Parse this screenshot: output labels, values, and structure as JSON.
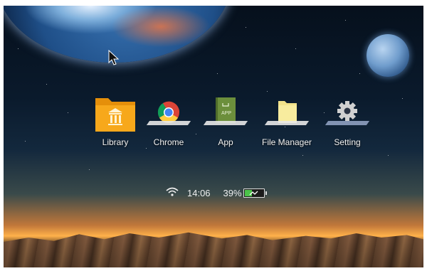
{
  "apps": [
    {
      "label": "Library",
      "icon": "library-folder-icon"
    },
    {
      "label": "Chrome",
      "icon": "chrome-icon"
    },
    {
      "label": "App",
      "icon": "app-icon"
    },
    {
      "label": "File Manager",
      "icon": "folder-icon"
    },
    {
      "label": "Setting",
      "icon": "gear-icon"
    }
  ],
  "status": {
    "wifi_icon": "wifi-icon",
    "time": "14:06",
    "battery_percent_label": "39%",
    "battery_level": 0.39,
    "battery_icon": "battery-charging-icon"
  },
  "app_icon_text": "APP",
  "colors": {
    "library_folder": "#f7a81b",
    "app_book": "#6c8f3c",
    "battery_fill": "#4cc24a",
    "gear": "#d0d0d0"
  }
}
